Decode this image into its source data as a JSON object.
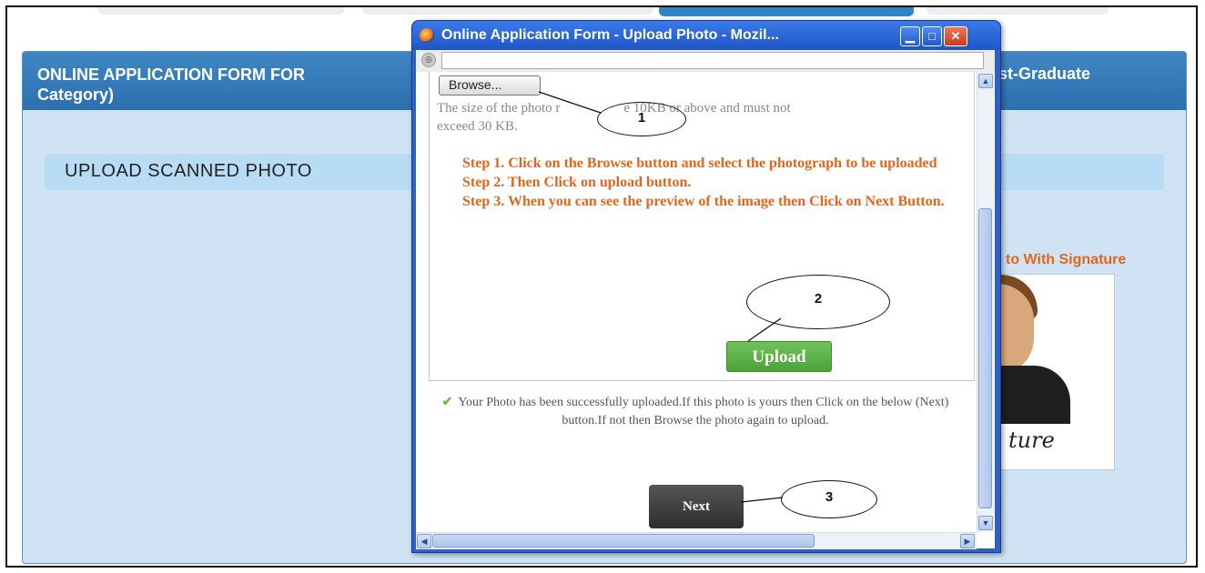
{
  "page": {
    "header_title": "ONLINE APPLICATION FORM FOR",
    "header_title_line2": "Category)",
    "header_title_right": "st-Graduate",
    "section_title": "UPLOAD SCANNED PHOTO",
    "photo_label": "to With Signature",
    "signature_text": "ture"
  },
  "popup": {
    "title": "Online Application Form - Upload Photo - Mozil...",
    "browse_label": "Browse...",
    "size_note_start": "The size of the photo r",
    "size_note_mid": "e 10KB or above and must not",
    "size_note_end": "exceed 30 KB.",
    "steps": [
      "Step 1. Click on the Browse button and select the photograph to be uploaded",
      "Step 2. Then Click on upload button.",
      "Step 3. When you can see the preview of the image then Click on Next Button."
    ],
    "upload_label": "Upload",
    "success_message": "Your Photo has been successfully uploaded.If this photo is yours then Click on the below (Next) button.If not then Browse the photo again to upload.",
    "next_label": "Next"
  },
  "callouts": [
    "1",
    "2",
    "3"
  ],
  "icons": {
    "browser": "firefox-icon",
    "address": "globe-icon",
    "success": "check-icon",
    "minimize": "minimize-icon",
    "maximize": "maximize-icon",
    "close": "close-icon"
  },
  "colors": {
    "header_blue": "#2d6fae",
    "instruction_orange": "#e0661e",
    "upload_green": "#4da33a",
    "next_dark": "#2e2e2e"
  }
}
